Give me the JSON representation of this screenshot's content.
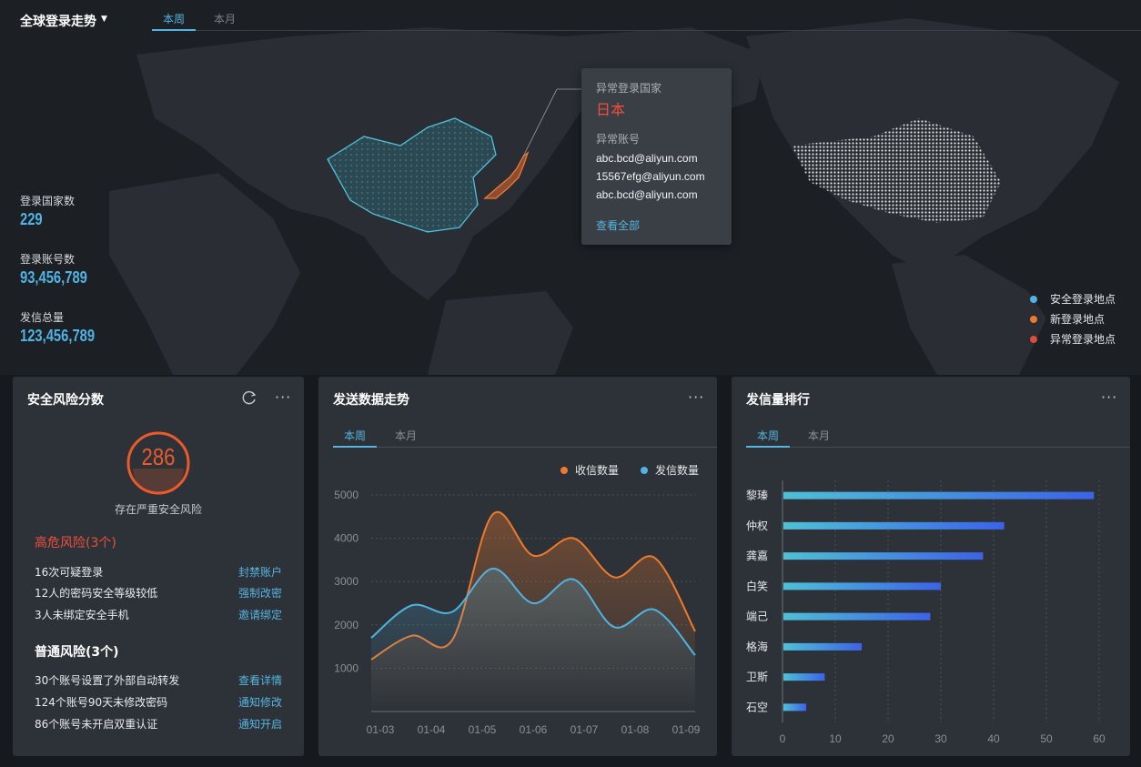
{
  "header": {
    "title": "全球登录走势",
    "tabs": [
      {
        "label": "本周",
        "active": true
      },
      {
        "label": "本月",
        "active": false
      }
    ]
  },
  "stats": [
    {
      "label": "登录国家数",
      "value": "229"
    },
    {
      "label": "登录账号数",
      "value": "93,456,789"
    },
    {
      "label": "发信总量",
      "value": "123,456,789"
    }
  ],
  "map_legend": [
    {
      "label": "安全登录地点",
      "color": "#4fb4e3"
    },
    {
      "label": "新登录地点",
      "color": "#f07a2c"
    },
    {
      "label": "异常登录地点",
      "color": "#e04b3a"
    }
  ],
  "tooltip": {
    "country_label": "异常登录国家",
    "country": "日本",
    "accounts_label": "异常账号",
    "accounts": [
      "abc.bcd@aliyun.com",
      "15567efg@aliyun.com",
      "abc.bcd@aliyun.com"
    ],
    "link": "查看全部"
  },
  "risk_panel": {
    "title": "安全风险分数",
    "refresh_icon": "refresh-icon",
    "more_icon": "more-icon",
    "score": "286",
    "score_caption": "存在严重安全风险",
    "high_title": "高危风险(3个)",
    "high_items": [
      {
        "text": "16次可疑登录",
        "action": "封禁账户"
      },
      {
        "text": "12人的密码安全等级较低",
        "action": "强制改密"
      },
      {
        "text": "3人未绑定安全手机",
        "action": "邀请绑定"
      }
    ],
    "normal_title": "普通风险(3个)",
    "normal_items": [
      {
        "text": "30个账号设置了外部自动转发",
        "action": "查看详情"
      },
      {
        "text": "124个账号90天未修改密码",
        "action": "通知修改"
      },
      {
        "text": "86个账号未开启双重认证",
        "action": "通知开启"
      }
    ],
    "colors": {
      "danger": "#f04e3e",
      "score": "#ec5a2c"
    }
  },
  "trend_panel": {
    "title": "发送数据走势",
    "tabs": [
      {
        "label": "本周",
        "active": true
      },
      {
        "label": "本月",
        "active": false
      }
    ],
    "more_icon": "more-icon"
  },
  "rank_panel": {
    "title": "发信量排行",
    "tabs": [
      {
        "label": "本周",
        "active": true
      },
      {
        "label": "本月",
        "active": false
      }
    ],
    "more_icon": "more-icon"
  },
  "chart_data": [
    {
      "type": "area",
      "title": "",
      "categories": [
        "01-03",
        "01-04",
        "01-05",
        "01-06",
        "01-07",
        "01-08",
        "01-09"
      ],
      "ylim": [
        0,
        5000
      ],
      "yticks": [
        1000,
        2000,
        3000,
        4000,
        5000
      ],
      "grid": true,
      "legend_position": "top-right",
      "series": [
        {
          "name": "收信数量",
          "color": "#f07a2c",
          "values": [
            1200,
            1750,
            1650,
            4550,
            3600,
            4000,
            3100,
            3550,
            1850
          ]
        },
        {
          "name": "发信数量",
          "color": "#4fb4e3",
          "values": [
            1700,
            2450,
            2300,
            3300,
            2500,
            3050,
            1950,
            2350,
            1300
          ]
        }
      ],
      "x_positions": [
        0.0,
        0.5,
        1.0,
        1.5,
        2.0,
        2.5,
        3.0,
        3.5,
        4.0,
        4.5,
        5.0,
        5.5,
        6.0
      ]
    },
    {
      "type": "bar",
      "orientation": "horizontal",
      "title": "",
      "categories": [
        "黎瑧",
        "仲权",
        "龚嘉",
        "白笑",
        "端己",
        "格海",
        "卫斯",
        "石空"
      ],
      "values": [
        59,
        42,
        38,
        30,
        28,
        15,
        8,
        4.5
      ],
      "xlim": [
        0,
        60
      ],
      "xticks": [
        0,
        10,
        20,
        30,
        40,
        50,
        60
      ],
      "grid": true
    }
  ]
}
